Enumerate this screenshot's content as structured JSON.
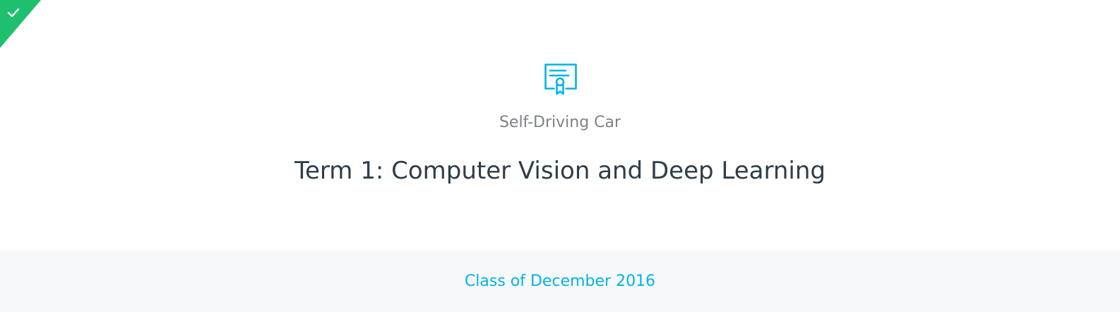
{
  "colors": {
    "completed_green": "#1ec06d",
    "accent_blue": "#02b3e4",
    "title_text": "#2e3d49",
    "subtitle_text": "#7d8288",
    "footer_background": "#f7f8fa"
  },
  "status": {
    "icon": "check-icon",
    "completed": true
  },
  "certificate": {
    "icon": "certificate-icon"
  },
  "program": {
    "name": "Self-Driving Car"
  },
  "course": {
    "title": "Term 1: Computer Vision and Deep Learning"
  },
  "footer": {
    "class_label": "Class of December 2016"
  }
}
